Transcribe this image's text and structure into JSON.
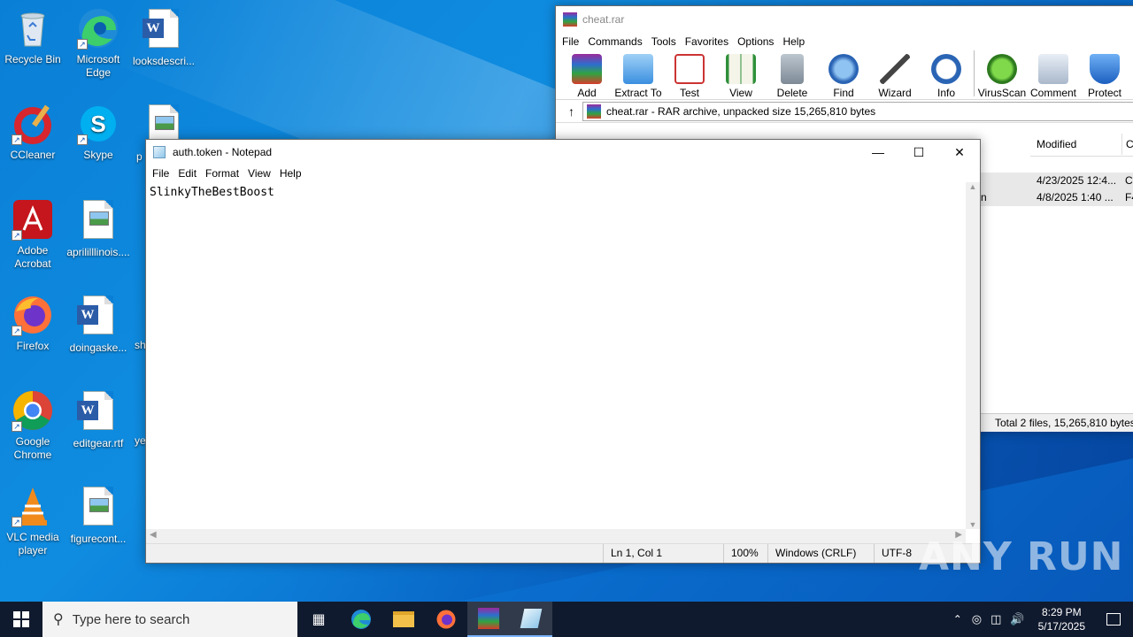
{
  "desktop": {
    "icons": [
      {
        "label": "Recycle Bin"
      },
      {
        "label": "Microsoft Edge"
      },
      {
        "label": "looksdescri..."
      },
      {
        "label": "CCleaner"
      },
      {
        "label": "Skype"
      },
      {
        "label": "p"
      },
      {
        "label": "Adobe Acrobat"
      },
      {
        "label": "aprililllinois...."
      },
      {
        "label": "Firefox"
      },
      {
        "label": "doingaske..."
      },
      {
        "label": "sh"
      },
      {
        "label": "Google Chrome"
      },
      {
        "label": "editgear.rtf"
      },
      {
        "label": "ye"
      },
      {
        "label": "VLC media player"
      },
      {
        "label": "figurecont..."
      }
    ]
  },
  "winrar": {
    "title": "cheat.rar",
    "menu": [
      "File",
      "Commands",
      "Tools",
      "Favorites",
      "Options",
      "Help"
    ],
    "toolbar": [
      "Add",
      "Extract To",
      "Test",
      "View",
      "Delete",
      "Find",
      "Wizard",
      "Info",
      "VirusScan",
      "Comment",
      "Protect"
    ],
    "path": "cheat.rar - RAR archive, unpacked size 15,265,810 bytes",
    "column_modified": "Modified",
    "column_c": "C",
    "rows": [
      {
        "name_tail": "",
        "modified": "4/23/2025 12:4...",
        "c": "C"
      },
      {
        "name_tail": "n",
        "modified": "4/8/2025 1:40 ...",
        "c": "F4"
      }
    ],
    "status": "Total 2 files, 15,265,810 bytes"
  },
  "notepad": {
    "title": "auth.token - Notepad",
    "menu": [
      "File",
      "Edit",
      "Format",
      "View",
      "Help"
    ],
    "content": "SlinkyTheBestBoost",
    "status": {
      "position": "Ln 1, Col 1",
      "zoom": "100%",
      "line_ending": "Windows (CRLF)",
      "encoding": "UTF-8"
    }
  },
  "taskbar": {
    "search_placeholder": "Type here to search",
    "time": "8:29 PM",
    "date": "5/17/2025"
  },
  "watermark": "ANY RUN"
}
